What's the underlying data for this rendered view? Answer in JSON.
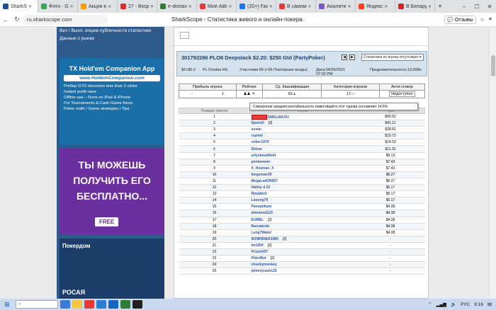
{
  "tabs": [
    {
      "title": "SharkS",
      "color": "#1f4f8a",
      "active": true
    },
    {
      "title": "Фото - G",
      "color": "#34a853"
    },
    {
      "title": "Акция в",
      "color": "#ff9800"
    },
    {
      "title": "27 - Вход",
      "color": "#d93025"
    },
    {
      "title": "e-dostav",
      "color": "#2e7d32"
    },
    {
      "title": "Мой Alib",
      "color": "#e53935"
    },
    {
      "title": "(20+) Fac",
      "color": "#1877f2"
    },
    {
      "title": "В самом",
      "color": "#e53935"
    },
    {
      "title": "Аналити",
      "color": "#7e57c2"
    },
    {
      "title": "Яндекс",
      "color": "#fc3f1d"
    },
    {
      "title": "В Беларус",
      "color": "#c62828"
    }
  ],
  "window_controls": {
    "minimize": "–",
    "maximize": "☐",
    "close": "✕"
  },
  "address": {
    "url": "ru.sharkscope.com",
    "page_title": "SharkScope - Статистика живого и онлайн-покера.",
    "reviews": "Отзывы"
  },
  "left": {
    "link1": "Вкл / Выкл. опцию публичности статистики",
    "link2": "Данные о рынке"
  },
  "banner1": {
    "title": "TX Hold'em Companion App",
    "url": "www.HoldemCompanion.com",
    "features": [
      "Preflop GTO decisions less than 2 clicks",
      "Instant profit raise",
      "Offline use – Runs on iPad & iPhone",
      "For Tournaments & Cash Game 6max",
      "Poker math / Game strategies / Tips"
    ]
  },
  "banner2": {
    "line1": "ТЫ МОЖЕШЬ",
    "line2": "ПОЛУЧИТЬ ЕГО",
    "line3": "БЕСПЛАТНО...",
    "free": "FREE"
  },
  "banner3": {
    "title": "Покердом",
    "sub": "РОСАЯ"
  },
  "tournament": {
    "title": "301792286 PLO8 Deepstack $2.20: $250 Gtd (PartyPoker)",
    "select": "Статистика по игроку отсутствует",
    "buyin": "$2+$0.2",
    "game": "PL Omaha H/L",
    "participants": "Участники:95 (+26 Повторные входы)",
    "date": "Дата:04/26/2021 07:00 PM",
    "duration": "Продолжительность:13,698s"
  },
  "summary": {
    "headers": [
      "Прибыль игрока",
      "Рейтинг",
      "Ср. Квалификация",
      "Категории игроков",
      "Анти-сговор"
    ],
    "profit": "-",
    "rating": "1",
    "qual": "63",
    "categories": "17",
    "anti": "Недоступно"
  },
  "tooltip": "Совокупная средняя рентабельность инвестиций в этот турнир составляет 14.5%",
  "results": {
    "headers": [
      "Позиция (место)",
      "Игрок",
      "Приз"
    ],
    "rows": [
      {
        "pos": "1",
        "player": "SMELIAKOU",
        "extra": "",
        "prize": "$60.52",
        "flag": true
      },
      {
        "pos": "2",
        "player": "Spoire0",
        "extra": "[2]",
        "prize": "$41.11"
      },
      {
        "pos": "3",
        "player": "sovan",
        "extra": "",
        "prize": "$28.81"
      },
      {
        "pos": "4",
        "player": "roymel",
        "extra": "",
        "prize": "$19.73"
      },
      {
        "pos": "5",
        "player": "relber1979",
        "extra": "",
        "prize": "$14.53"
      },
      {
        "pos": "6",
        "player": "Shirax",
        "extra": "",
        "prize": "$11.32"
      },
      {
        "pos": "7",
        "player": "urlyshouldfold",
        "extra": "",
        "prize": "$9.13"
      },
      {
        "pos": "8",
        "player": "perimenein",
        "extra": "",
        "prize": "$7.43"
      },
      {
        "pos": "9",
        "player": "X_Hosman_X",
        "extra": "",
        "prize": "$7.43"
      },
      {
        "pos": "10",
        "player": "kingxman39",
        "extra": "",
        "prize": "$6.27"
      },
      {
        "pos": "11",
        "player": "MegaLadON007",
        "extra": "",
        "prize": "$6.27"
      },
      {
        "pos": "12",
        "player": "Harley d 22",
        "extra": "",
        "prize": "$5.17"
      },
      {
        "pos": "13",
        "player": "Rjnjatkx5",
        "extra": "",
        "prize": "$5.17"
      },
      {
        "pos": "14",
        "player": "Laoong79",
        "extra": "",
        "prize": "$5.17"
      },
      {
        "pos": "15",
        "player": "Panoptikum",
        "extra": "",
        "prize": "$4.38"
      },
      {
        "pos": "16",
        "player": "elmelund123",
        "extra": "",
        "prize": "$4.38"
      },
      {
        "pos": "17",
        "player": "EUMEL",
        "extra": "[2]",
        "prize": "$4.38"
      },
      {
        "pos": "18",
        "player": "Barcakroki",
        "extra": "",
        "prize": "$4.38"
      },
      {
        "pos": "19",
        "player": "Lung7Water",
        "extra": "",
        "prize": "$4.38"
      },
      {
        "pos": "20",
        "player": "MJWINNER1980",
        "extra": "[2]",
        "prize": "-"
      },
      {
        "pos": "21",
        "player": "tm1000",
        "extra": "[2]",
        "prize": "-"
      },
      {
        "pos": "22",
        "player": "Pr1zer007",
        "extra": "",
        "prize": "-"
      },
      {
        "pos": "23",
        "player": "PidorBot",
        "extra": "[2]",
        "prize": "-"
      },
      {
        "pos": "24",
        "player": "chunkymonkey",
        "extra": "",
        "prize": "-"
      },
      {
        "pos": "25",
        "player": "johnnycash125",
        "extra": "",
        "prize": "-"
      }
    ]
  },
  "taskbar": {
    "search": "",
    "lang": "РУС",
    "time": "9:16"
  }
}
